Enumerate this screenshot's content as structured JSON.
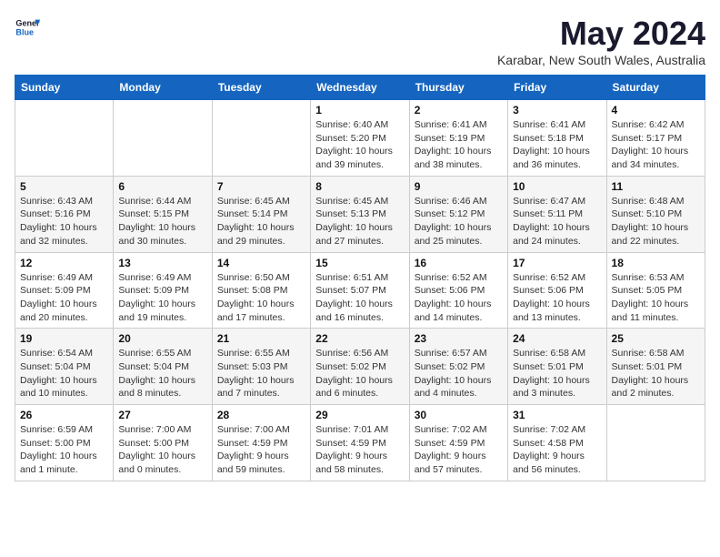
{
  "logo": {
    "line1": "General",
    "line2": "Blue"
  },
  "title": "May 2024",
  "subtitle": "Karabar, New South Wales, Australia",
  "days_header": [
    "Sunday",
    "Monday",
    "Tuesday",
    "Wednesday",
    "Thursday",
    "Friday",
    "Saturday"
  ],
  "weeks": [
    [
      {
        "day": "",
        "info": ""
      },
      {
        "day": "",
        "info": ""
      },
      {
        "day": "",
        "info": ""
      },
      {
        "day": "1",
        "info": "Sunrise: 6:40 AM\nSunset: 5:20 PM\nDaylight: 10 hours\nand 39 minutes."
      },
      {
        "day": "2",
        "info": "Sunrise: 6:41 AM\nSunset: 5:19 PM\nDaylight: 10 hours\nand 38 minutes."
      },
      {
        "day": "3",
        "info": "Sunrise: 6:41 AM\nSunset: 5:18 PM\nDaylight: 10 hours\nand 36 minutes."
      },
      {
        "day": "4",
        "info": "Sunrise: 6:42 AM\nSunset: 5:17 PM\nDaylight: 10 hours\nand 34 minutes."
      }
    ],
    [
      {
        "day": "5",
        "info": "Sunrise: 6:43 AM\nSunset: 5:16 PM\nDaylight: 10 hours\nand 32 minutes."
      },
      {
        "day": "6",
        "info": "Sunrise: 6:44 AM\nSunset: 5:15 PM\nDaylight: 10 hours\nand 30 minutes."
      },
      {
        "day": "7",
        "info": "Sunrise: 6:45 AM\nSunset: 5:14 PM\nDaylight: 10 hours\nand 29 minutes."
      },
      {
        "day": "8",
        "info": "Sunrise: 6:45 AM\nSunset: 5:13 PM\nDaylight: 10 hours\nand 27 minutes."
      },
      {
        "day": "9",
        "info": "Sunrise: 6:46 AM\nSunset: 5:12 PM\nDaylight: 10 hours\nand 25 minutes."
      },
      {
        "day": "10",
        "info": "Sunrise: 6:47 AM\nSunset: 5:11 PM\nDaylight: 10 hours\nand 24 minutes."
      },
      {
        "day": "11",
        "info": "Sunrise: 6:48 AM\nSunset: 5:10 PM\nDaylight: 10 hours\nand 22 minutes."
      }
    ],
    [
      {
        "day": "12",
        "info": "Sunrise: 6:49 AM\nSunset: 5:09 PM\nDaylight: 10 hours\nand 20 minutes."
      },
      {
        "day": "13",
        "info": "Sunrise: 6:49 AM\nSunset: 5:09 PM\nDaylight: 10 hours\nand 19 minutes."
      },
      {
        "day": "14",
        "info": "Sunrise: 6:50 AM\nSunset: 5:08 PM\nDaylight: 10 hours\nand 17 minutes."
      },
      {
        "day": "15",
        "info": "Sunrise: 6:51 AM\nSunset: 5:07 PM\nDaylight: 10 hours\nand 16 minutes."
      },
      {
        "day": "16",
        "info": "Sunrise: 6:52 AM\nSunset: 5:06 PM\nDaylight: 10 hours\nand 14 minutes."
      },
      {
        "day": "17",
        "info": "Sunrise: 6:52 AM\nSunset: 5:06 PM\nDaylight: 10 hours\nand 13 minutes."
      },
      {
        "day": "18",
        "info": "Sunrise: 6:53 AM\nSunset: 5:05 PM\nDaylight: 10 hours\nand 11 minutes."
      }
    ],
    [
      {
        "day": "19",
        "info": "Sunrise: 6:54 AM\nSunset: 5:04 PM\nDaylight: 10 hours\nand 10 minutes."
      },
      {
        "day": "20",
        "info": "Sunrise: 6:55 AM\nSunset: 5:04 PM\nDaylight: 10 hours\nand 8 minutes."
      },
      {
        "day": "21",
        "info": "Sunrise: 6:55 AM\nSunset: 5:03 PM\nDaylight: 10 hours\nand 7 minutes."
      },
      {
        "day": "22",
        "info": "Sunrise: 6:56 AM\nSunset: 5:02 PM\nDaylight: 10 hours\nand 6 minutes."
      },
      {
        "day": "23",
        "info": "Sunrise: 6:57 AM\nSunset: 5:02 PM\nDaylight: 10 hours\nand 4 minutes."
      },
      {
        "day": "24",
        "info": "Sunrise: 6:58 AM\nSunset: 5:01 PM\nDaylight: 10 hours\nand 3 minutes."
      },
      {
        "day": "25",
        "info": "Sunrise: 6:58 AM\nSunset: 5:01 PM\nDaylight: 10 hours\nand 2 minutes."
      }
    ],
    [
      {
        "day": "26",
        "info": "Sunrise: 6:59 AM\nSunset: 5:00 PM\nDaylight: 10 hours\nand 1 minute."
      },
      {
        "day": "27",
        "info": "Sunrise: 7:00 AM\nSunset: 5:00 PM\nDaylight: 10 hours\nand 0 minutes."
      },
      {
        "day": "28",
        "info": "Sunrise: 7:00 AM\nSunset: 4:59 PM\nDaylight: 9 hours\nand 59 minutes."
      },
      {
        "day": "29",
        "info": "Sunrise: 7:01 AM\nSunset: 4:59 PM\nDaylight: 9 hours\nand 58 minutes."
      },
      {
        "day": "30",
        "info": "Sunrise: 7:02 AM\nSunset: 4:59 PM\nDaylight: 9 hours\nand 57 minutes."
      },
      {
        "day": "31",
        "info": "Sunrise: 7:02 AM\nSunset: 4:58 PM\nDaylight: 9 hours\nand 56 minutes."
      },
      {
        "day": "",
        "info": ""
      }
    ]
  ]
}
